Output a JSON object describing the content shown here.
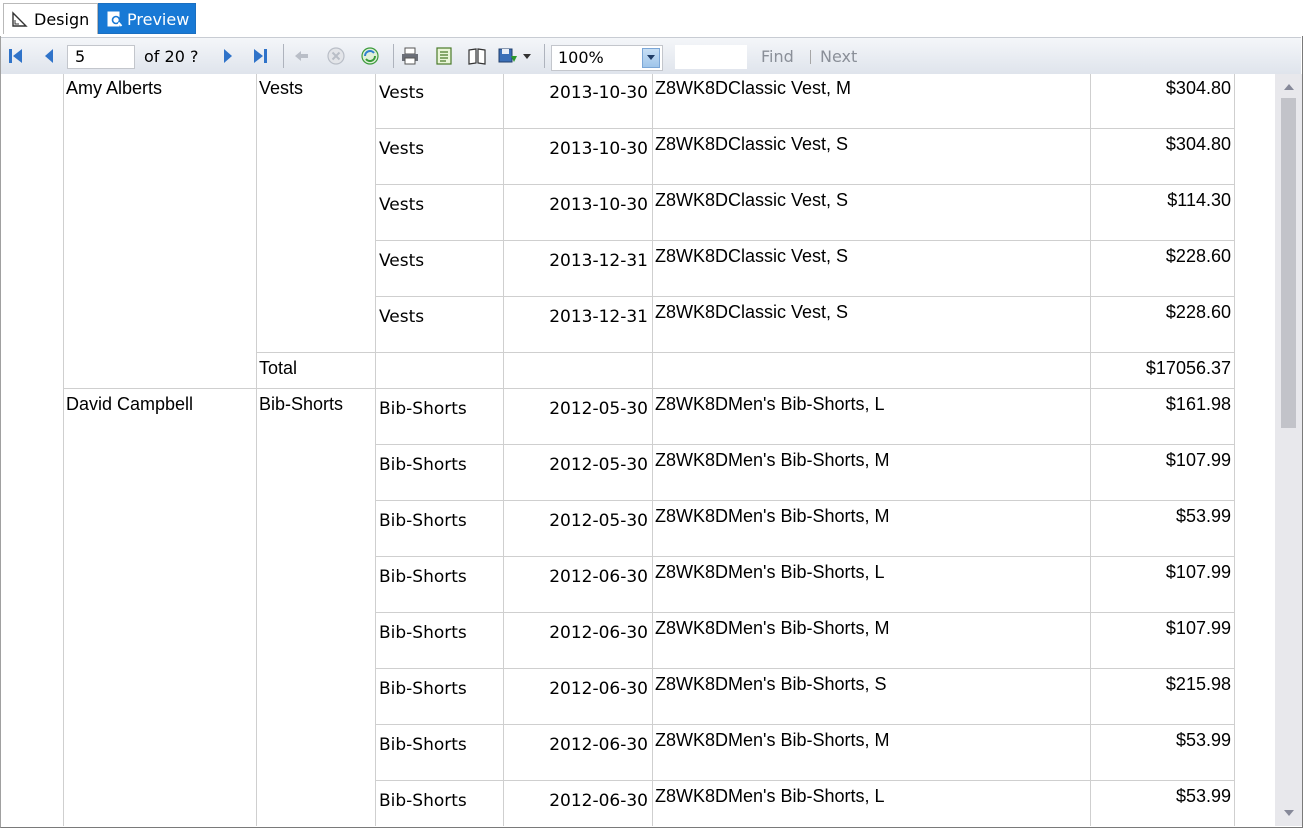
{
  "tabs": {
    "design": "Design",
    "preview": "Preview"
  },
  "toolbar": {
    "page_current": "5",
    "page_of": "of  20 ?",
    "zoom": "100%",
    "find": "Find",
    "next": "Next"
  },
  "report": {
    "group1": {
      "person": "Amy Alberts",
      "category": "Vests",
      "rows": [
        {
          "sub": "Vests",
          "date": "2013-10-30",
          "product": "Z8WK8DClassic Vest, M",
          "amount": "$304.80"
        },
        {
          "sub": "Vests",
          "date": "2013-10-30",
          "product": "Z8WK8DClassic Vest, S",
          "amount": "$304.80"
        },
        {
          "sub": "Vests",
          "date": "2013-10-30",
          "product": "Z8WK8DClassic Vest, S",
          "amount": "$114.30"
        },
        {
          "sub": "Vests",
          "date": "2013-12-31",
          "product": "Z8WK8DClassic Vest, S",
          "amount": "$228.60"
        },
        {
          "sub": "Vests",
          "date": "2013-12-31",
          "product": "Z8WK8DClassic Vest, S",
          "amount": "$228.60"
        }
      ],
      "total_label": "Total",
      "total_amount": "$17056.37"
    },
    "group2": {
      "person": "David Campbell",
      "category": "Bib-Shorts",
      "rows": [
        {
          "sub": "Bib-Shorts",
          "date": "2012-05-30",
          "product": "Z8WK8DMen's Bib-Shorts, L",
          "amount": "$161.98"
        },
        {
          "sub": "Bib-Shorts",
          "date": "2012-05-30",
          "product": "Z8WK8DMen's Bib-Shorts, M",
          "amount": "$107.99"
        },
        {
          "sub": "Bib-Shorts",
          "date": "2012-05-30",
          "product": "Z8WK8DMen's Bib-Shorts, M",
          "amount": "$53.99"
        },
        {
          "sub": "Bib-Shorts",
          "date": "2012-06-30",
          "product": "Z8WK8DMen's Bib-Shorts, L",
          "amount": "$107.99"
        },
        {
          "sub": "Bib-Shorts",
          "date": "2012-06-30",
          "product": "Z8WK8DMen's Bib-Shorts, M",
          "amount": "$107.99"
        },
        {
          "sub": "Bib-Shorts",
          "date": "2012-06-30",
          "product": "Z8WK8DMen's Bib-Shorts, S",
          "amount": "$215.98"
        },
        {
          "sub": "Bib-Shorts",
          "date": "2012-06-30",
          "product": "Z8WK8DMen's Bib-Shorts, M",
          "amount": "$53.99"
        },
        {
          "sub": "Bib-Shorts",
          "date": "2012-06-30",
          "product": "Z8WK8DMen's Bib-Shorts, L",
          "amount": "$53.99"
        }
      ]
    }
  }
}
